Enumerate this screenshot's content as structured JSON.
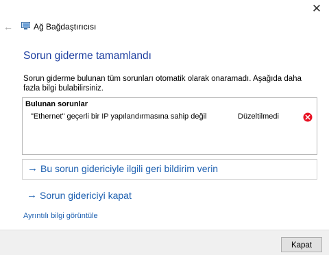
{
  "window": {
    "title": "Ağ Bağdaştırıcısı",
    "close_glyph": "✕",
    "back_glyph": "←"
  },
  "main": {
    "heading": "Sorun giderme tamamlandı",
    "description": "Sorun giderme bulunan tüm sorunları otomatik olarak onaramadı. Aşağıda daha fazla bilgi bulabilirsiniz.",
    "problems": {
      "header": "Bulunan sorunlar",
      "items": [
        {
          "text": "\"Ethernet\" geçerli bir IP yapılandırmasına sahip değil",
          "status": "Düzeltilmedi",
          "icon": "error-icon"
        }
      ]
    },
    "links": {
      "feedback": "Bu sorun gidericiyle ilgili geri bildirim verin",
      "close_troubleshooter": "Sorun gidericiyi kapat",
      "details": "Ayrıntılı bilgi görüntüle",
      "arrow_glyph": "→"
    }
  },
  "footer": {
    "close_label": "Kapat"
  },
  "colors": {
    "heading": "#1e3fa0",
    "link": "#1c5fb0",
    "error": "#e81123"
  }
}
